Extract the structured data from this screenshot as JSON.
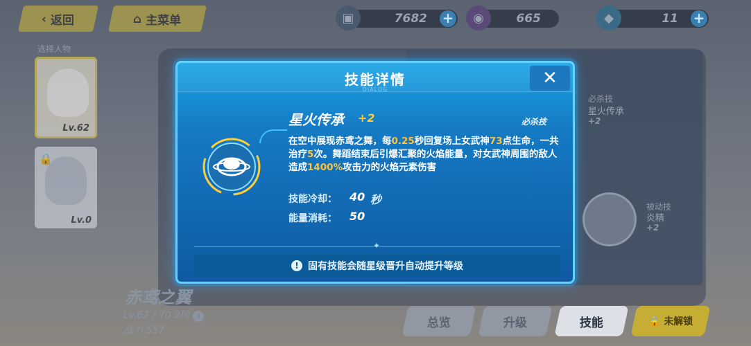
{
  "topbar": {
    "back_label": "返回",
    "menu_label": "主菜单",
    "resources": [
      {
        "icon": "dumbbell-icon",
        "value": "7682"
      },
      {
        "icon": "crystal-orb-icon",
        "value": "665"
      },
      {
        "icon": "stamina-crystal-icon",
        "value": "11"
      }
    ]
  },
  "character_list": {
    "label": "选择人物",
    "cards": [
      {
        "level": "Lv.62",
        "active": true,
        "locked": false
      },
      {
        "level": "Lv.0",
        "active": false,
        "locked": true
      }
    ]
  },
  "character": {
    "name": "赤鸢之翼",
    "level": "Lv.62",
    "level_cap": "/ 70",
    "rank": "2阶",
    "power_label": "战力",
    "power_value": "557"
  },
  "background_skills": {
    "ultimate_label": "必杀技",
    "ultimate_name": "星火传承",
    "ultimate_plus": "+2",
    "passive_label": "被动技",
    "passive_name": "炎精",
    "passive_plus": "+2"
  },
  "tabs": [
    {
      "label": "总览",
      "active": false
    },
    {
      "label": "升级",
      "active": false
    },
    {
      "label": "技能",
      "active": true
    },
    {
      "label": "未解锁",
      "active": false,
      "locked": true
    }
  ],
  "dialog": {
    "title": "技能详情",
    "subtitle": "DIALOG",
    "close_label": "✕",
    "skill": {
      "name": "星火传承",
      "plus": "+2",
      "type": "必杀技",
      "description": [
        {
          "text": "在空中展现赤鸢之舞，每",
          "hl": false
        },
        {
          "text": "0.25",
          "hl": true
        },
        {
          "text": "秒回复场上女武神",
          "hl": false
        },
        {
          "text": "73",
          "hl": true
        },
        {
          "text": "点生命，一共治疗",
          "hl": false
        },
        {
          "text": "5",
          "hl": true
        },
        {
          "text": "次。舞蹈结束后引爆汇聚的火焰能量，对女武神周围的敌人造成",
          "hl": false
        },
        {
          "text": "1400%",
          "hl": true
        },
        {
          "text": "攻击力的火焰元素伤害",
          "hl": false
        }
      ],
      "cooldown_label": "技能冷却：",
      "cooldown_value": "40",
      "cooldown_unit": "秒",
      "energy_label": "能量消耗：",
      "energy_value": "50"
    },
    "notice": "固有技能会随星级晋升自动提升等级"
  },
  "colors": {
    "dialog_blue": "#157ac4",
    "highlight": "#ffc23a",
    "accent_yellow": "#c7b23a"
  }
}
